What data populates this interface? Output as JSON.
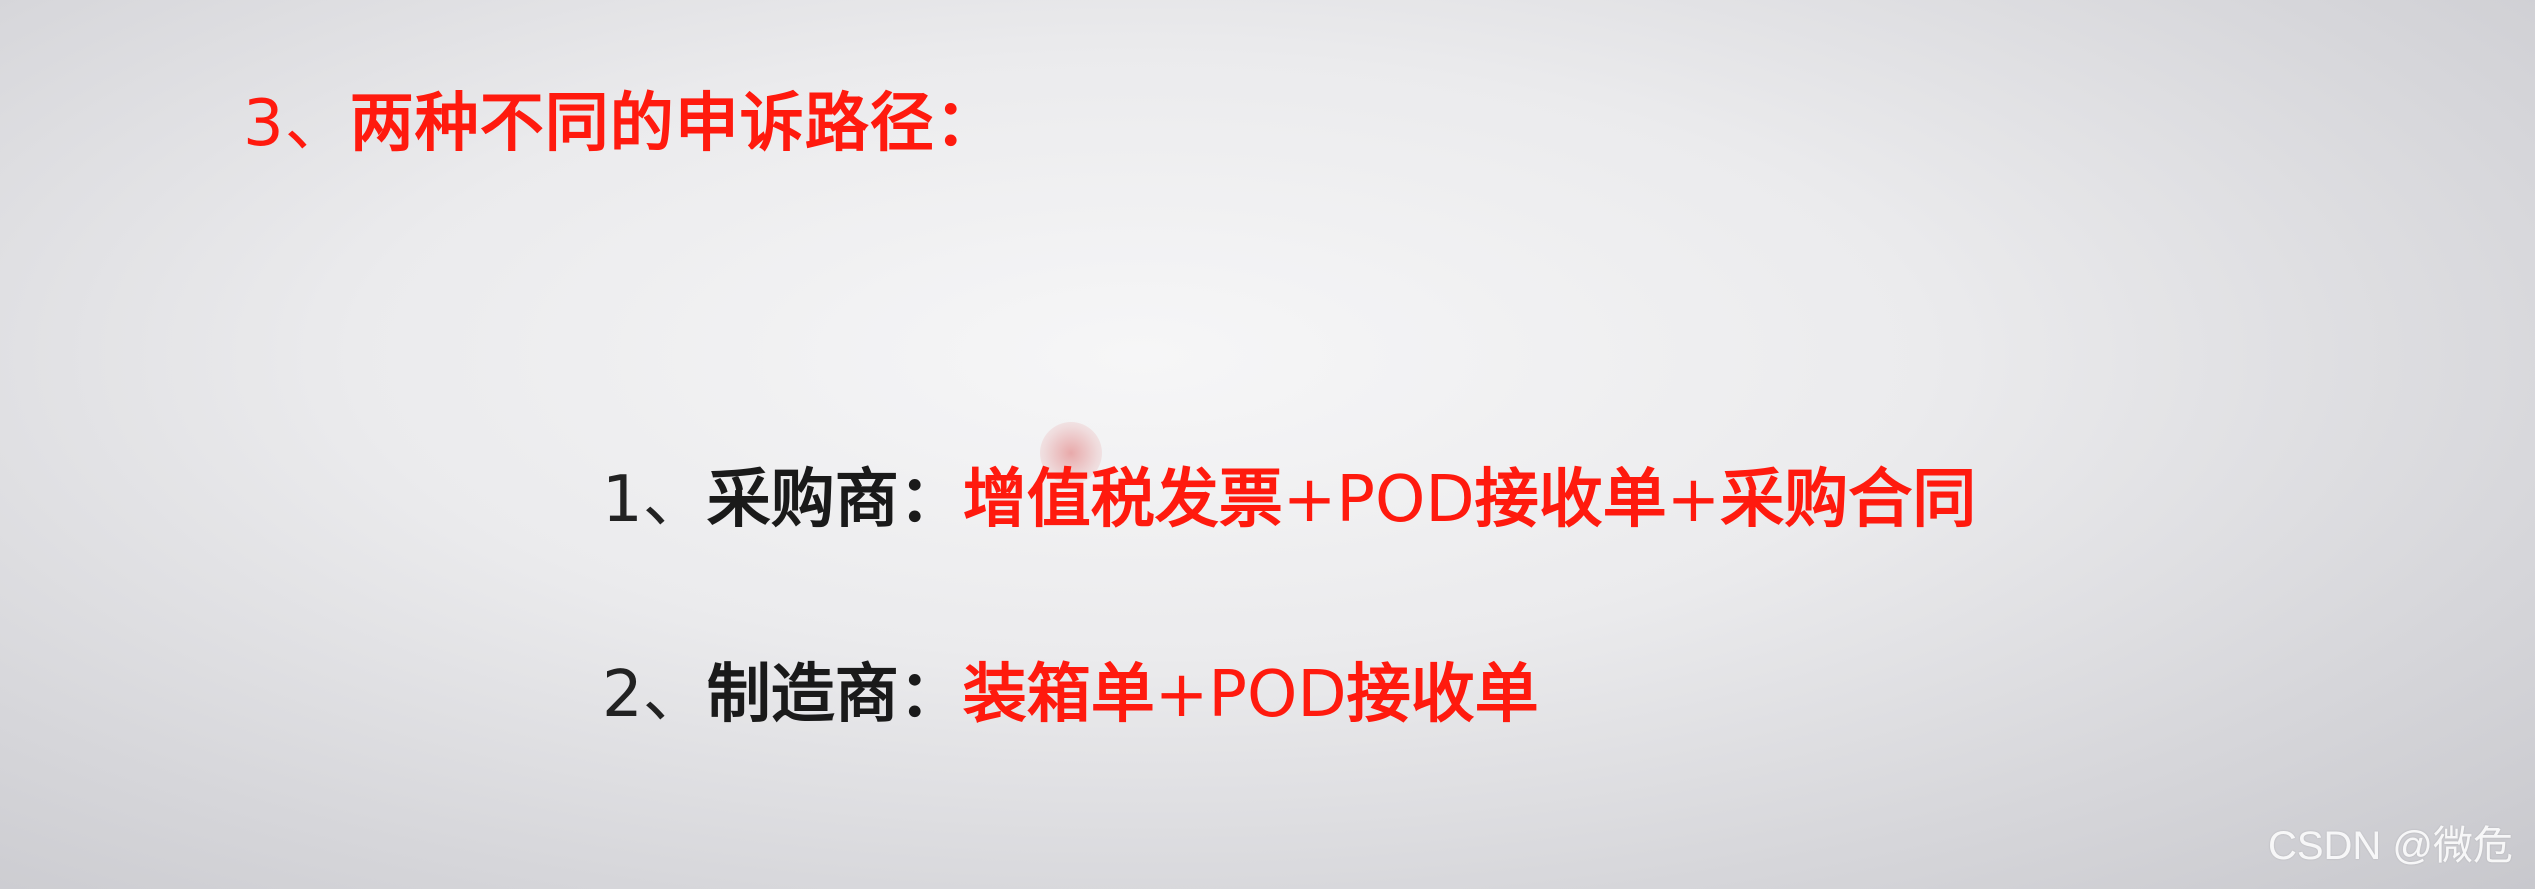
{
  "heading": {
    "number": "3、",
    "text": "两种不同的申诉路径："
  },
  "items": [
    {
      "number": "1、",
      "party": "采购商：",
      "docs": [
        {
          "text": "增值税发票",
          "style": "bold"
        },
        {
          "text": "+POD",
          "style": "normal"
        },
        {
          "text": "接收单",
          "style": "bold"
        },
        {
          "text": "+",
          "style": "normal"
        },
        {
          "text": "采购合同",
          "style": "bold"
        }
      ]
    },
    {
      "number": "2、",
      "party": "制造商：",
      "docs": [
        {
          "text": "装箱单",
          "style": "bold"
        },
        {
          "text": "+POD",
          "style": "normal"
        },
        {
          "text": "接收单",
          "style": "bold"
        }
      ]
    }
  ],
  "watermark": "CSDN @微危",
  "colors": {
    "accent": "#ff1a0e",
    "text": "#1a1a1a"
  }
}
